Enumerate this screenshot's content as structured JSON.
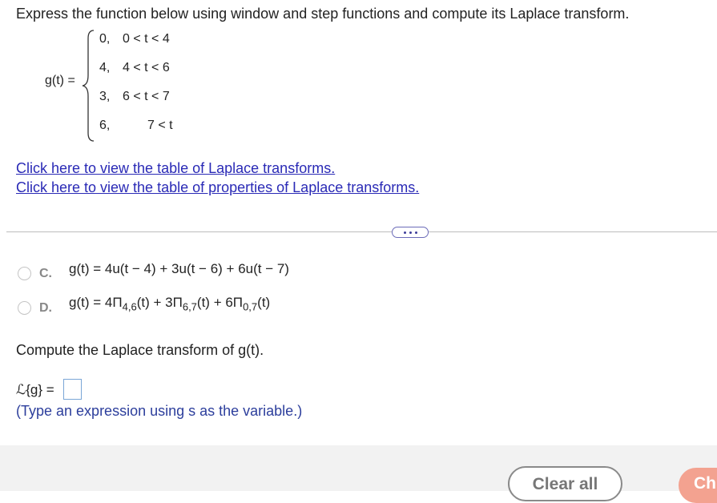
{
  "question": {
    "title": "Express the function below using window and step functions and compute its Laplace transform.",
    "function_label": "g(t) =",
    "cases": [
      {
        "value": "0,",
        "condition": "0 < t < 4"
      },
      {
        "value": "4,",
        "condition": "4 < t < 6"
      },
      {
        "value": "3,",
        "condition": "6 < t < 7"
      },
      {
        "value": "6,",
        "condition": "7 < t"
      }
    ]
  },
  "links": {
    "laplace_table": "Click here to view the table of Laplace transforms.",
    "properties_table": "Click here to view the table of properties of Laplace transforms."
  },
  "options": [
    {
      "letter": "C.",
      "text": "g(t) = 4u(t − 4) + 3u(t − 6) + 6u(t − 7)"
    },
    {
      "letter": "D.",
      "prefix": "g(t) = ",
      "terms": [
        {
          "coef": "4Π",
          "sub": "4,6",
          "arg": "(t)"
        },
        {
          "coef": " + 3Π",
          "sub": "6,7",
          "arg": "(t)"
        },
        {
          "coef": " + 6Π",
          "sub": "0,7",
          "arg": "(t)"
        }
      ]
    }
  ],
  "part2": {
    "prompt": "Compute the Laplace transform of g(t).",
    "laplace_label": "ℒ{g} =",
    "hint": "(Type an expression using s as the variable.)"
  },
  "footer": {
    "clear_label": "Clear all",
    "check_label": "Ch"
  }
}
